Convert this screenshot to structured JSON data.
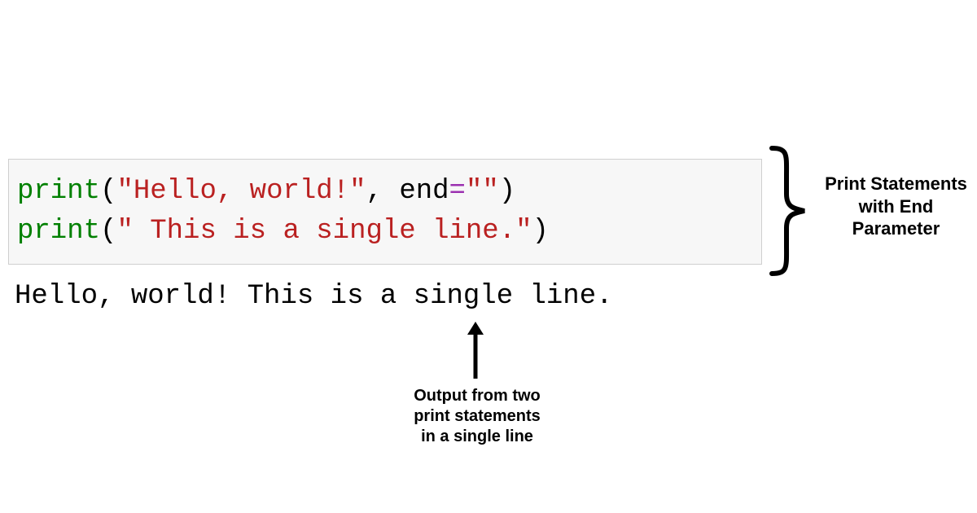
{
  "code": {
    "line1": {
      "func": "print",
      "open": "(",
      "str": "\"Hello, world!\"",
      "comma": ",",
      "space": " ",
      "arg": "end",
      "eq": "=",
      "val": "\"\"",
      "close": ")"
    },
    "line2": {
      "func": "print",
      "open": "(",
      "str": "\" This is a single line.\"",
      "close": ")"
    }
  },
  "output": "Hello, world! This is a single line.",
  "annotations": {
    "brace_label": "Print Statements with End Parameter",
    "arrow_label": "Output from two print statements in a single line"
  },
  "colors": {
    "code_bg": "#f7f7f7",
    "code_border": "#cfcfcf",
    "syntax_func": "#008000",
    "syntax_str": "#BA2121",
    "syntax_eq": "#9b30b0",
    "syntax_default": "#000000"
  }
}
